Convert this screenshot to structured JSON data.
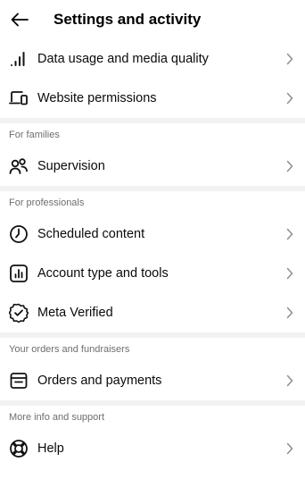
{
  "header": {
    "title": "Settings and activity",
    "back_icon": "back-arrow-icon"
  },
  "groups": [
    {
      "items": [
        {
          "label": "Data usage and media quality",
          "icon": "signal-bars-icon"
        },
        {
          "label": "Website permissions",
          "icon": "devices-icon"
        }
      ]
    },
    {
      "section": "For families",
      "items": [
        {
          "label": "Supervision",
          "icon": "people-icon"
        }
      ]
    },
    {
      "section": "For professionals",
      "items": [
        {
          "label": "Scheduled content",
          "icon": "clock-icon"
        },
        {
          "label": "Account type and tools",
          "icon": "chart-box-icon"
        },
        {
          "label": "Meta Verified",
          "icon": "verified-badge-icon"
        }
      ]
    },
    {
      "section": "Your orders and fundraisers",
      "items": [
        {
          "label": "Orders and payments",
          "icon": "receipt-icon"
        }
      ]
    },
    {
      "section": "More info and support",
      "items": [
        {
          "label": "Help",
          "icon": "lifebuoy-icon"
        }
      ]
    }
  ],
  "colors": {
    "text": "#0a0a0a",
    "section_text": "#6e6e6e",
    "divider": "#f2f2f2",
    "chevron": "#8e8e8e"
  }
}
